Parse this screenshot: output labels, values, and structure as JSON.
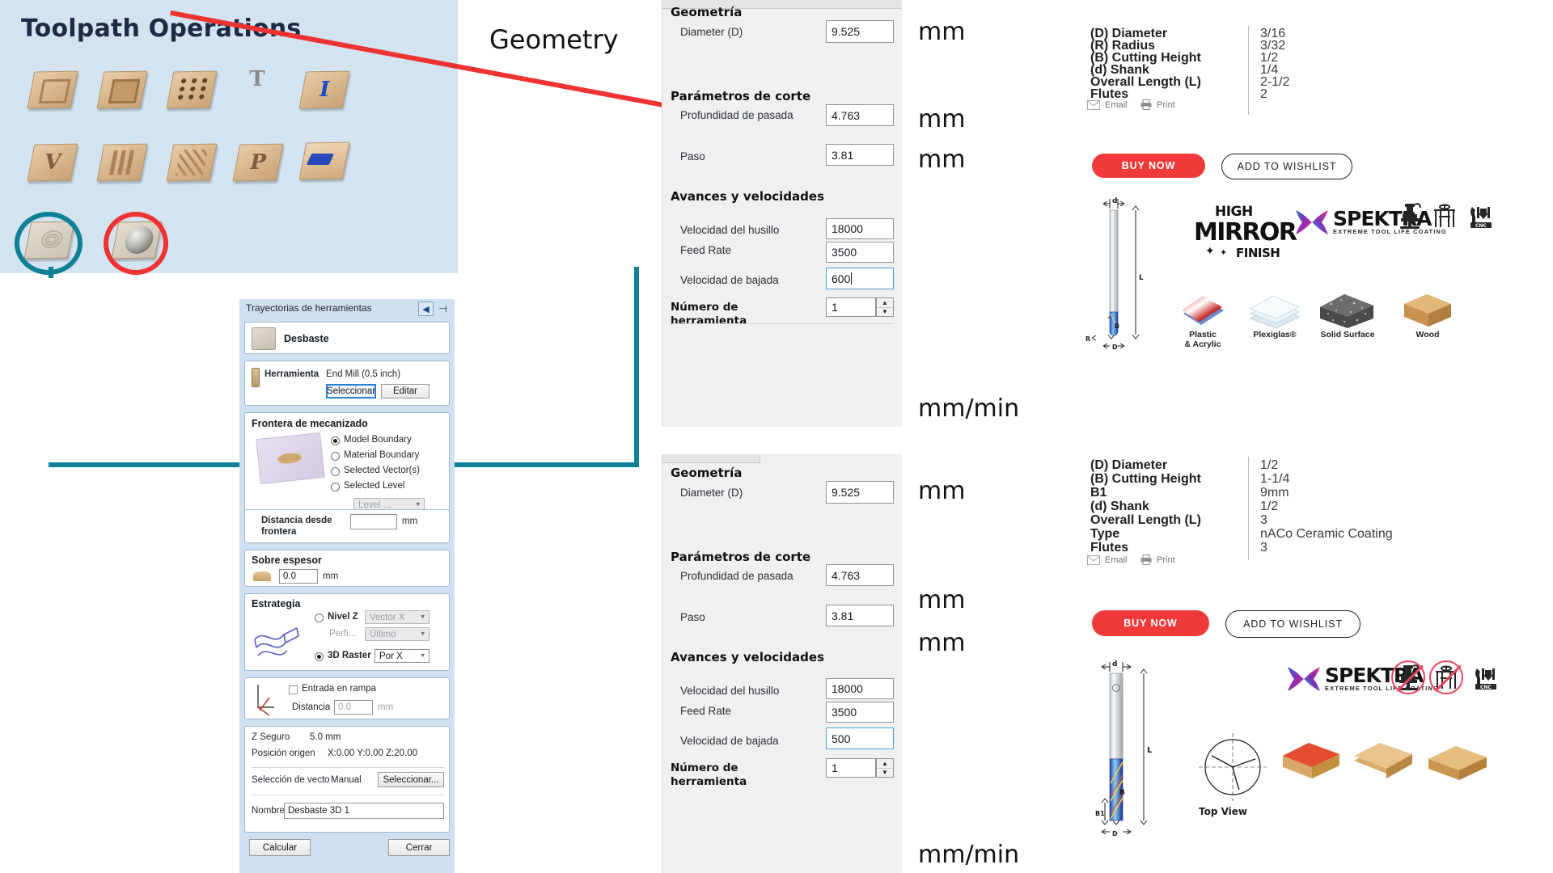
{
  "toolpath_panel": {
    "title": "Toolpath Operations",
    "icons": [
      {
        "name": "profile-toolpath-icon",
        "label": "Profile"
      },
      {
        "name": "pocket-toolpath-icon",
        "label": "Pocket"
      },
      {
        "name": "drilling-toolpath-icon",
        "label": "Drilling"
      },
      {
        "name": "quick-engrave-toolpath-icon",
        "label": "Quick Engrave"
      },
      {
        "name": "inlay-toolpath-icon",
        "label": "Inlay"
      },
      {
        "name": "vcarve-toolpath-icon",
        "label": "V-Carve"
      },
      {
        "name": "fluting-toolpath-icon",
        "label": "Fluting"
      },
      {
        "name": "texture-toolpath-icon",
        "label": "Texture"
      },
      {
        "name": "prism-carving-toolpath-icon",
        "label": "Prism Carving"
      },
      {
        "name": "moulding-toolpath-icon",
        "label": "Moulding"
      },
      {
        "name": "rough-machining-toolpath-icon",
        "label": "Rough Machining"
      },
      {
        "name": "finish-machining-toolpath-icon",
        "label": "Finish Machining"
      }
    ],
    "highlight_teal": "#0d8096",
    "highlight_red": "#ef3232"
  },
  "annotations": {
    "geometry": "Geometry",
    "mm": "mm",
    "mm_min": "mm/min"
  },
  "traj_dialog": {
    "title": "Trayectorias de herramientas",
    "operation": "Desbaste",
    "tool_label": "Herramienta",
    "tool_value": "End Mill (0.5 inch)",
    "select_button": "Seleccionar",
    "edit_button": "Editar",
    "boundary_title": "Frontera de mecanizado",
    "boundary_options": [
      "Model Boundary",
      "Material Boundary",
      "Selected Vector(s)",
      "Selected Level"
    ],
    "boundary_selected": "Model Boundary",
    "level_select": "Level ...",
    "distance_label": "Distancia desde frontera",
    "distance_value": "",
    "distance_unit": "mm",
    "allowance_title": "Sobre espesor",
    "allowance_value": "0.0",
    "allowance_unit": "mm",
    "strategy_title": "Estrategia",
    "strategy_zlevel": "Nivel Z",
    "strategy_zlevel_select": "Vector X",
    "strategy_profile": "Perfi...",
    "strategy_profile_select": "Último",
    "strategy_raster": "3D Raster",
    "strategy_raster_select": "Por X",
    "strategy_selected": "3D Raster",
    "ramp_checkbox": "Entrada en rampa",
    "ramp_distance_label": "Distancia",
    "ramp_distance_value": "0.0",
    "ramp_distance_unit": "mm",
    "safe_z_label": "Z Seguro",
    "safe_z_value": "5.0 mm",
    "home_label": "Posición origen",
    "home_value": "X:0.00 Y:0.00 Z:20.00",
    "vector_label": "Selección de vecto",
    "vector_value": "Manual",
    "vector_button": "Seleccionar...",
    "name_label": "Nombre",
    "name_value": "Desbaste 3D 1",
    "calc_button": "Calcular",
    "close_button": "Cerrar"
  },
  "param_top": {
    "geometry_title": "Geometría",
    "diameter_label": "Diameter (D)",
    "diameter_value": "9.525",
    "cut_title": "Parámetros de corte",
    "pass_depth_label": "Profundidad de pasada",
    "pass_depth_value": "4.763",
    "stepover_label": "Paso",
    "stepover_value": "3.81",
    "feeds_title": "Avances y velocidades",
    "spindle_label": "Velocidad del husillo",
    "spindle_value": "18000",
    "feed_label": "Feed Rate",
    "feed_value": "3500",
    "plunge_label": "Velocidad de bajada",
    "plunge_value": "600",
    "toolnum_label": "Número de herramienta",
    "toolnum_value": "1"
  },
  "param_bottom": {
    "geometry_title": "Geometría",
    "diameter_label": "Diameter (D)",
    "diameter_value": "9.525",
    "cut_title": "Parámetros de corte",
    "pass_depth_label": "Profundidad de pasada",
    "pass_depth_value": "4.763",
    "stepover_label": "Paso",
    "stepover_value": "3.81",
    "feeds_title": "Avances y velocidades",
    "spindle_label": "Velocidad del husillo",
    "spindle_value": "18000",
    "feed_label": "Feed Rate",
    "feed_value": "3500",
    "plunge_label": "Velocidad de bajada",
    "plunge_value": "500",
    "toolnum_label": "Número de herramienta",
    "toolnum_value": "1"
  },
  "product_top": {
    "specs": [
      {
        "key": "(D) Diameter",
        "value": "3/16"
      },
      {
        "key": "(R) Radius",
        "value": "3/32"
      },
      {
        "key": "(B) Cutting Height",
        "value": "1/2"
      },
      {
        "key": "(d) Shank",
        "value": "1/4"
      },
      {
        "key": "Overall Length (L)",
        "value": "2-1/2"
      },
      {
        "key": "Flutes",
        "value": "2"
      }
    ],
    "email_link": "Email",
    "print_link": "Print",
    "buy_button": "BUY NOW",
    "wishlist_button": "ADD TO WISHLIST",
    "dim_d": "d",
    "dim_L": "L",
    "dim_B": "B",
    "dim_R": "R",
    "dim_D": "D",
    "badge_high": "HIGH",
    "badge_mirror": "MIRROR",
    "badge_finish": "FINISH",
    "brand_name": "SPEKTRA",
    "brand_tagline": "EXTREME TOOL LIFE COATING",
    "materials": [
      {
        "name": "plastic-acrylic",
        "label": "Plastic\n& Acrylic"
      },
      {
        "name": "plexiglas",
        "label": "Plexiglas®"
      },
      {
        "name": "solid-surface",
        "label": "Solid Surface"
      },
      {
        "name": "wood",
        "label": "Wood"
      }
    ],
    "machines": [
      {
        "name": "router-icon",
        "banned": false
      },
      {
        "name": "table-saw-icon",
        "banned": false
      },
      {
        "name": "cnc-icon",
        "banned": false,
        "label": "CNC"
      }
    ]
  },
  "product_bottom": {
    "specs": [
      {
        "key": "(D) Diameter",
        "value": "1/2"
      },
      {
        "key": "(B) Cutting Height",
        "value": "1-1/4"
      },
      {
        "key": "B1",
        "value": "9mm"
      },
      {
        "key": "(d) Shank",
        "value": "1/2"
      },
      {
        "key": "Overall Length (L)",
        "value": "3"
      },
      {
        "key": "Type",
        "value": "nACo Ceramic Coating"
      },
      {
        "key": "Flutes",
        "value": "3"
      }
    ],
    "email_link": "Email",
    "print_link": "Print",
    "buy_button": "BUY NOW",
    "wishlist_button": "ADD TO WISHLIST",
    "dim_d": "d",
    "dim_L": "L",
    "dim_B": "B",
    "dim_B1": "B1",
    "dim_D": "D",
    "top_view_label": "Top View",
    "brand_name": "SPEKTRA",
    "brand_tagline": "EXTREME TOOL LIFE COATING",
    "machines": [
      {
        "name": "router-icon",
        "banned": true
      },
      {
        "name": "table-saw-icon",
        "banned": true
      },
      {
        "name": "cnc-icon",
        "banned": false,
        "label": "CNC"
      }
    ]
  }
}
